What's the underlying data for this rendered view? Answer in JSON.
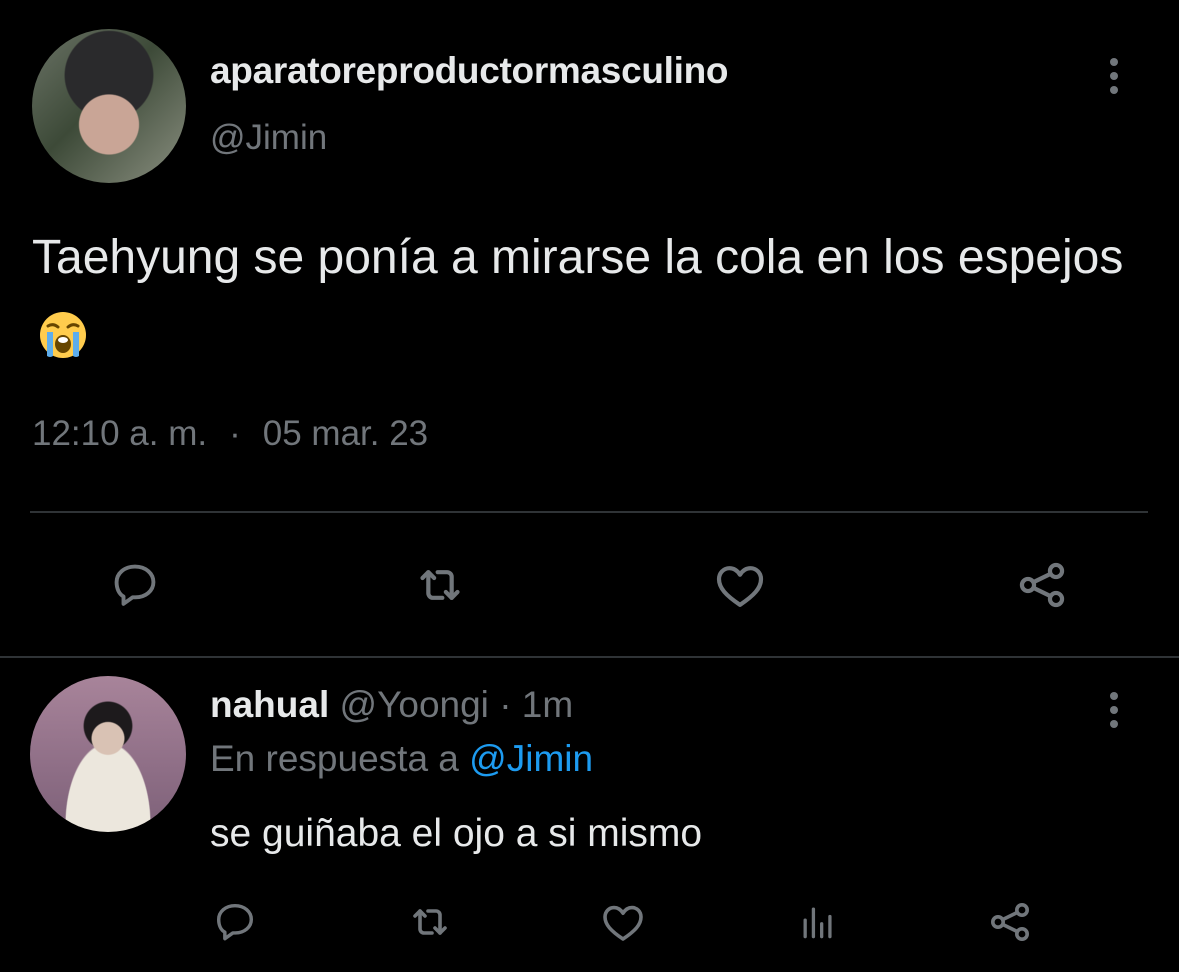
{
  "tweet": {
    "display_name": "aparatoreproductormasculino",
    "handle": "@Jimin",
    "text": "Taehyung se ponía a mirarse la cola en los espejos",
    "emoji": "loudly-crying-face",
    "time": "12:10 a. m.",
    "separator": "·",
    "date": "05 mar. 23",
    "actions": [
      "reply-icon",
      "retweet-icon",
      "like-icon",
      "share-icon"
    ]
  },
  "reply": {
    "display_name": "nahual",
    "handle": "@Yoongi",
    "separator": "·",
    "age": "1m",
    "in_reply_prefix": "En respuesta a",
    "in_reply_to": "@Jimin",
    "text": "se guiñaba el ojo a si mismo",
    "actions": [
      "reply-icon",
      "retweet-icon",
      "like-icon",
      "analytics-icon",
      "share-icon"
    ]
  },
  "colors": {
    "background": "#000000",
    "text_primary": "#e7e9ea",
    "text_secondary": "#71767b",
    "accent": "#1d9bf0",
    "divider": "#2f3336"
  }
}
